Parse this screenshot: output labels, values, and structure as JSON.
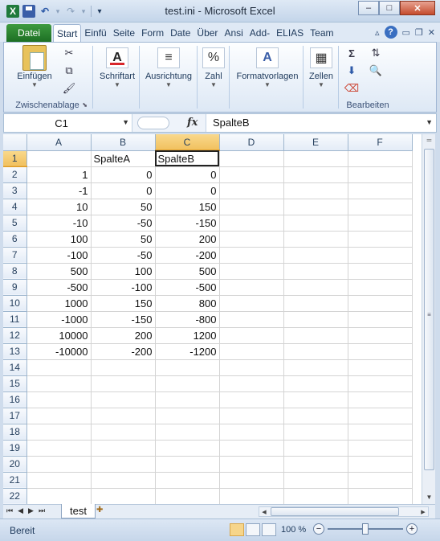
{
  "window": {
    "title": "test.ini  -  Microsoft Excel",
    "minimize": "–",
    "maximize": "□",
    "close": "✕"
  },
  "qat": {
    "undo": "↶",
    "redo": "↷",
    "dropdown": "▾",
    "customize": "▾"
  },
  "ribbon_tabs": {
    "file": "Datei",
    "tabs": [
      "Start",
      "Einfü",
      "Seite",
      "Form",
      "Date",
      "Über",
      "Ansi",
      "Add-",
      "ELIAS",
      "Team"
    ]
  },
  "ribbon": {
    "clipboard": {
      "paste": "Einfügen",
      "label": "Zwischenablage"
    },
    "font": {
      "label": "Schriftart"
    },
    "alignment": {
      "label": "Ausrichtung"
    },
    "number": {
      "label": "Zahl",
      "icon_text": "%"
    },
    "styles": {
      "label": "Formatvorlagen"
    },
    "cells": {
      "label": "Zellen"
    },
    "editing": {
      "label": "Bearbeiten",
      "sum": "Σ"
    }
  },
  "formula_bar": {
    "name_box": "C1",
    "fx": "fx",
    "content": "SpalteB"
  },
  "grid": {
    "columns": [
      "A",
      "B",
      "C",
      "D",
      "E",
      "F"
    ],
    "selected_column": "C",
    "selected_row": 1,
    "active_cell": "C1",
    "rows": [
      {
        "n": "1",
        "A": "",
        "B": "SpalteA",
        "C": "SpalteB"
      },
      {
        "n": "2",
        "A": "1",
        "B": "0",
        "C": "0"
      },
      {
        "n": "3",
        "A": "-1",
        "B": "0",
        "C": "0"
      },
      {
        "n": "4",
        "A": "10",
        "B": "50",
        "C": "150"
      },
      {
        "n": "5",
        "A": "-10",
        "B": "-50",
        "C": "-150"
      },
      {
        "n": "6",
        "A": "100",
        "B": "50",
        "C": "200"
      },
      {
        "n": "7",
        "A": "-100",
        "B": "-50",
        "C": "-200"
      },
      {
        "n": "8",
        "A": "500",
        "B": "100",
        "C": "500"
      },
      {
        "n": "9",
        "A": "-500",
        "B": "-100",
        "C": "-500"
      },
      {
        "n": "10",
        "A": "1000",
        "B": "150",
        "C": "800"
      },
      {
        "n": "11",
        "A": "-1000",
        "B": "-150",
        "C": "-800"
      },
      {
        "n": "12",
        "A": "10000",
        "B": "200",
        "C": "1200"
      },
      {
        "n": "13",
        "A": "-10000",
        "B": "-200",
        "C": "-1200"
      },
      {
        "n": "14",
        "A": "",
        "B": "",
        "C": ""
      },
      {
        "n": "15",
        "A": "",
        "B": "",
        "C": ""
      },
      {
        "n": "16",
        "A": "",
        "B": "",
        "C": ""
      },
      {
        "n": "17",
        "A": "",
        "B": "",
        "C": ""
      },
      {
        "n": "18",
        "A": "",
        "B": "",
        "C": ""
      },
      {
        "n": "19",
        "A": "",
        "B": "",
        "C": ""
      },
      {
        "n": "20",
        "A": "",
        "B": "",
        "C": ""
      },
      {
        "n": "21",
        "A": "",
        "B": "",
        "C": ""
      },
      {
        "n": "22",
        "A": "",
        "B": "",
        "C": ""
      }
    ]
  },
  "sheets": {
    "tabs": [
      "test"
    ],
    "nav": [
      "⏮",
      "◀",
      "▶",
      "⏭"
    ]
  },
  "status": {
    "ready": "Bereit",
    "zoom": "100 %",
    "zoom_minus": "−",
    "zoom_plus": "+"
  },
  "colors": {
    "file_tab": "#2a8a2e",
    "selected_header": "#f1c15f",
    "close_button": "#c44b2c"
  }
}
